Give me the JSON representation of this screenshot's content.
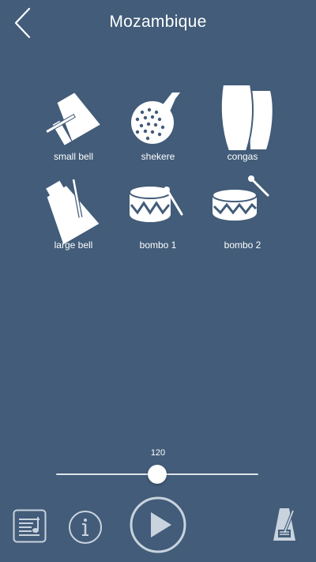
{
  "header": {
    "title": "Mozambique"
  },
  "instruments": [
    {
      "label": "small bell",
      "icon": "small-bell-icon"
    },
    {
      "label": "shekere",
      "icon": "shekere-icon"
    },
    {
      "label": "congas",
      "icon": "congas-icon"
    },
    {
      "label": "large bell",
      "icon": "large-bell-icon"
    },
    {
      "label": "bombo 1",
      "icon": "bombo-drum-icon"
    },
    {
      "label": "bombo 2",
      "icon": "bombo-drum-icon"
    }
  ],
  "tempo": {
    "value": "120",
    "slider_fraction": 0.5
  },
  "toolbar": {
    "buttons": [
      "score-sheet-icon",
      "info-icon",
      "play-icon",
      "metronome-icon"
    ]
  },
  "colors": {
    "background": "#425c79",
    "foreground": "#ffffff",
    "button_outline": "#c9d3de"
  }
}
